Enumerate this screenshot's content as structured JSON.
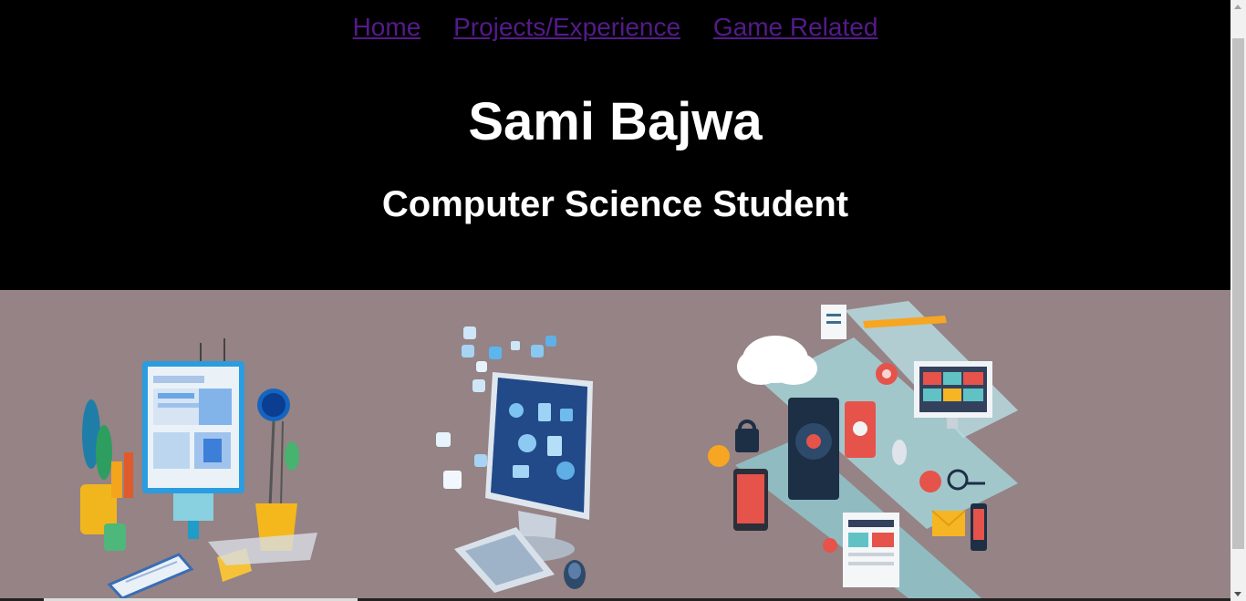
{
  "nav": {
    "items": [
      {
        "label": "Home"
      },
      {
        "label": "Projects/Experience"
      },
      {
        "label": "Game Related"
      }
    ]
  },
  "hero": {
    "name": "Sami Bajwa",
    "subtitle": "Computer Science Student"
  },
  "banner": {
    "background": "#958385",
    "illustrations": [
      {
        "name": "web-design-illustration"
      },
      {
        "name": "computer-apps-illustration"
      },
      {
        "name": "technology-network-illustration"
      }
    ]
  },
  "colors": {
    "link": "#551a8b",
    "header_bg": "#000000",
    "text": "#ffffff"
  }
}
